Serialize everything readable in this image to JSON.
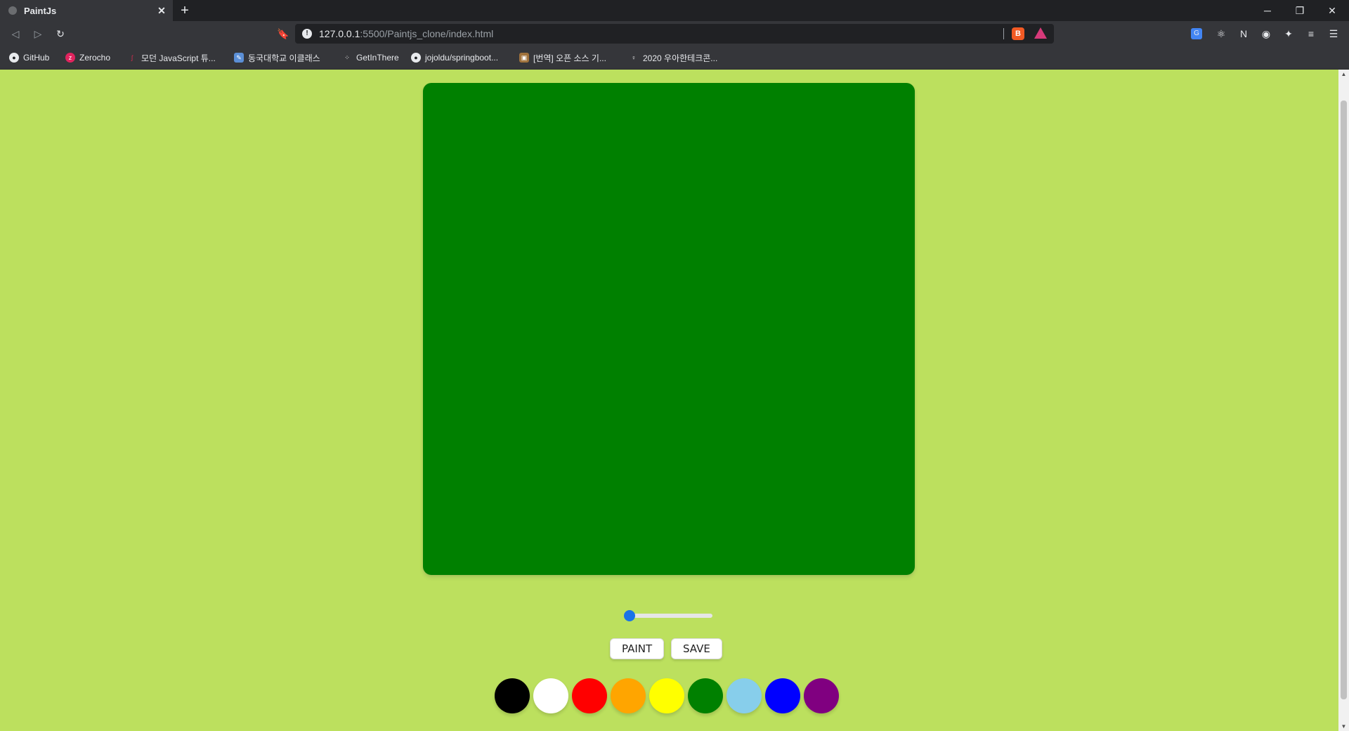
{
  "browser": {
    "tab_title": "PaintJs",
    "tab_close": "✕",
    "new_tab": "+",
    "url_host": "127.0.0.1",
    "url_path": ":5500/Paintjs_clone/index.html",
    "window_controls": {
      "minimize": "─",
      "restore": "❐",
      "close": "✕"
    },
    "bookmarks": [
      {
        "label": "GitHub",
        "icon": "github-icon"
      },
      {
        "label": "Zerocho",
        "icon": "zerocho-icon"
      },
      {
        "label": "모던 JavaScript 튜...",
        "icon": "javascript-info-icon"
      },
      {
        "label": "동국대학교 이클래스",
        "icon": "eclass-icon"
      },
      {
        "label": "GetInThere",
        "icon": "getinthere-icon"
      },
      {
        "label": "jojoldu/springboot...",
        "icon": "github-icon"
      },
      {
        "label": "[번역] 오픈 소스 기...",
        "icon": "article-icon"
      },
      {
        "label": "2020 우아한테크콘...",
        "icon": "woowa-icon"
      }
    ]
  },
  "app": {
    "canvas_color": "#008000",
    "brush_size": {
      "min": 0.1,
      "max": 5.0,
      "value": 0.1
    },
    "buttons": {
      "paint": "PAINT",
      "save": "SAVE"
    },
    "colors": [
      "#000000",
      "#ffffff",
      "#ff0000",
      "#ffa500",
      "#ffff00",
      "#008000",
      "#87ceeb",
      "#0000ff",
      "#800080"
    ]
  }
}
